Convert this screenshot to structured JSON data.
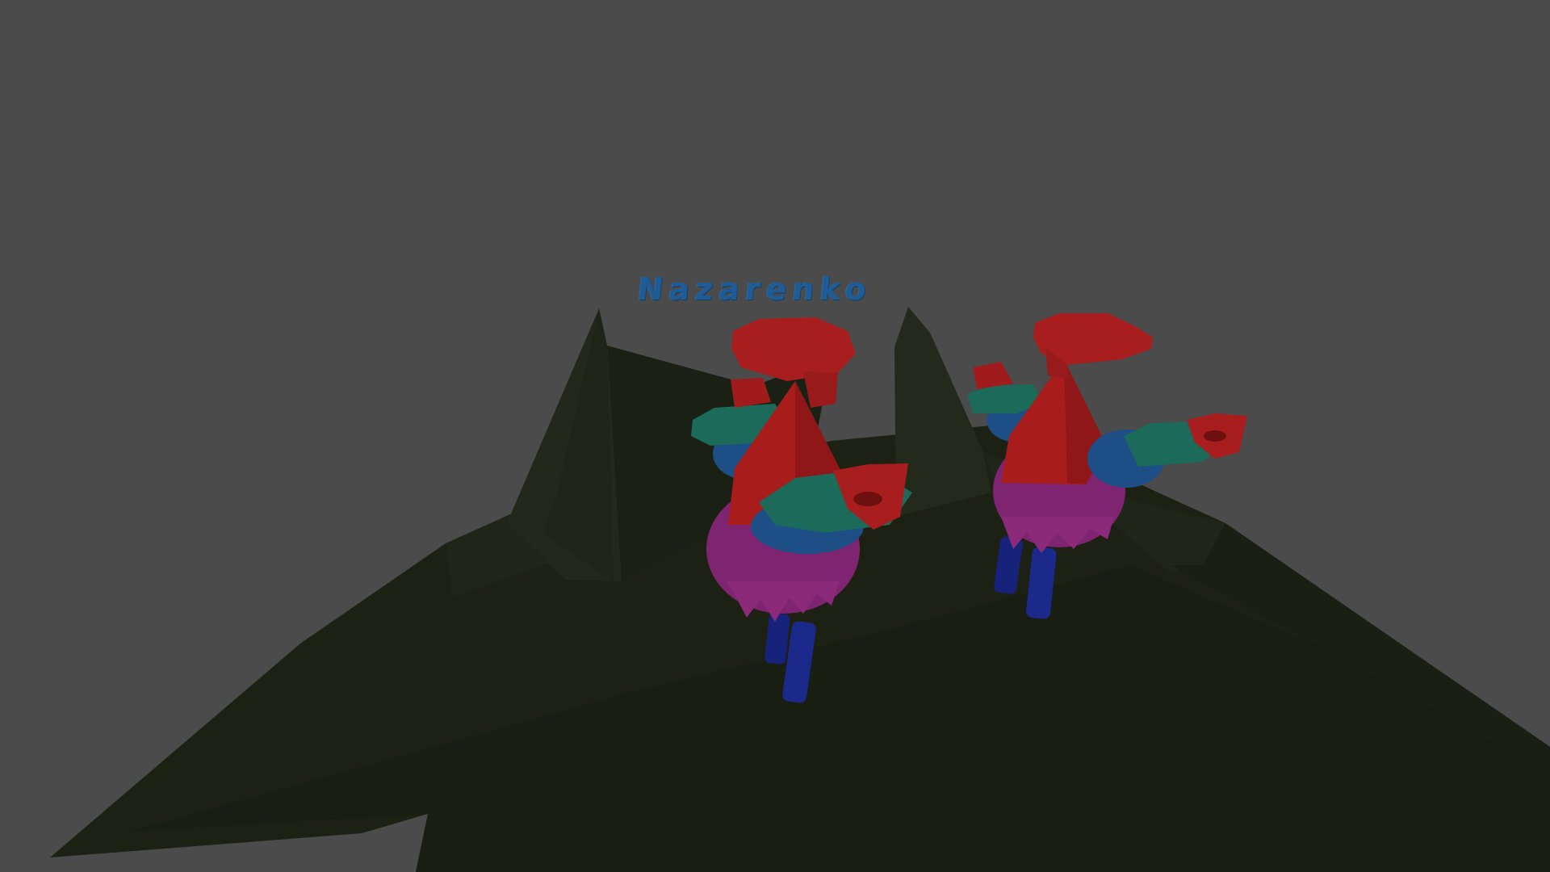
{
  "scene": {
    "player_name": "Nazarenko",
    "colors": {
      "background": "#4b4b4b",
      "terrain": "#1c2114",
      "terrain_light": "#25301e",
      "name_text": "#1f5b94",
      "hat": "#a81e1e",
      "cone": "#b01c1c",
      "body": "#8a2a78",
      "leg": "#1b2a8a",
      "collar_blue": "#1d4f86",
      "collar_teal": "#1b6a5a"
    },
    "characters": [
      "character-left",
      "character-right"
    ]
  }
}
